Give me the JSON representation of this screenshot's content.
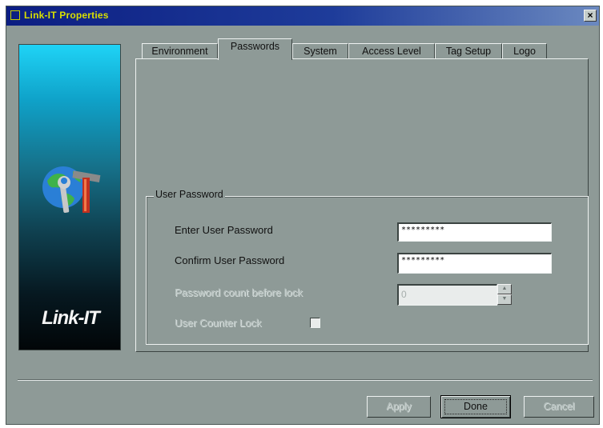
{
  "window": {
    "title": "Link-IT Properties",
    "close_glyph": "×"
  },
  "brand": {
    "logo_text": "Link-IT",
    "icon": "globe-wrench-hammer-icon"
  },
  "tabs": [
    {
      "label": "Environment",
      "active": false
    },
    {
      "label": "Passwords",
      "active": true
    },
    {
      "label": "System",
      "active": false
    },
    {
      "label": "Access Level",
      "active": false
    },
    {
      "label": "Tag Setup",
      "active": false
    },
    {
      "label": "Logo",
      "active": false
    }
  ],
  "group": {
    "label": "User Password"
  },
  "fields": {
    "enter_label": "Enter User Password",
    "enter_value": "*********",
    "confirm_label": "Confirm User Password",
    "confirm_value": "*********",
    "count_label": "Password count before lock",
    "count_value": "0",
    "lock_label": "User Counter Lock",
    "lock_checked": false
  },
  "buttons": {
    "apply": "Apply",
    "done": "Done",
    "cancel": "Cancel"
  },
  "colors": {
    "dialog_bg": "#8e9a97",
    "title_bar": "#0c1e82",
    "title_text": "#d8e000"
  }
}
